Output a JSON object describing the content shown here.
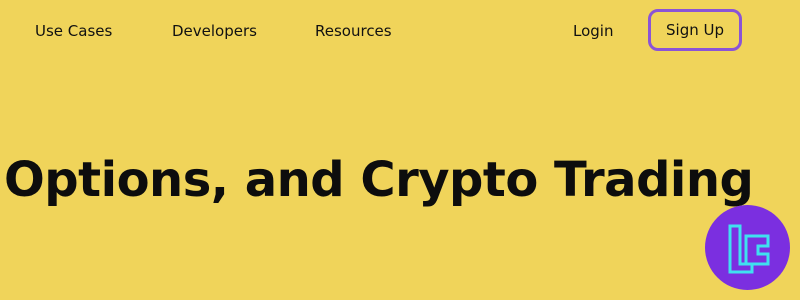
{
  "nav": {
    "items": [
      {
        "label": "Use Cases"
      },
      {
        "label": "Developers"
      },
      {
        "label": "Resources"
      }
    ],
    "login_label": "Login",
    "signup_label": "Sign Up"
  },
  "hero": {
    "title": "Options, and Crypto Trading"
  },
  "badge": {
    "icon": "tc-logo-icon"
  },
  "colors": {
    "background": "#F0D45A",
    "signup_border": "#8B54D6",
    "badge_bg": "#7B2FE0",
    "badge_icon": "#3FE0F0"
  }
}
